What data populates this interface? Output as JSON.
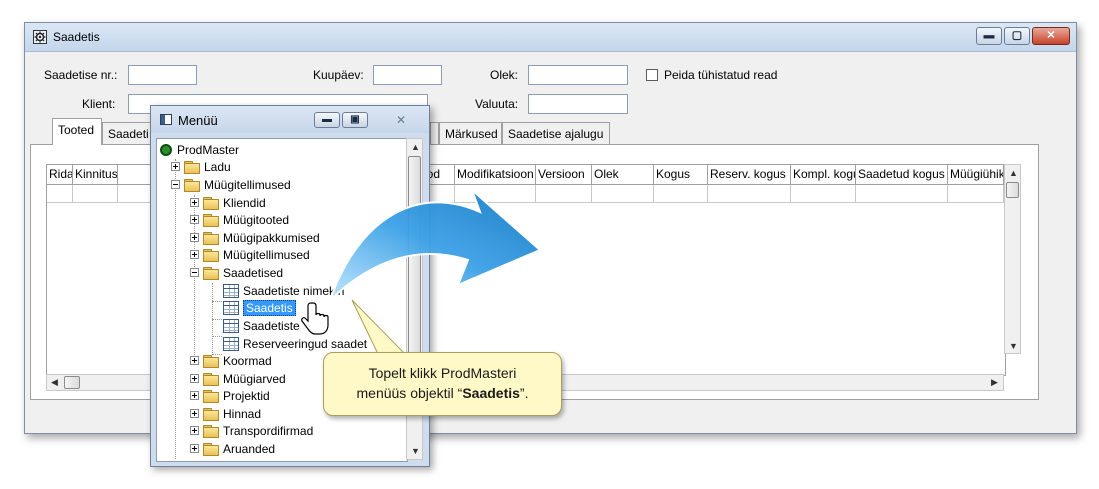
{
  "window": {
    "title": "Saadetis",
    "buttons": {
      "minimize": "▬",
      "maximize": "▢",
      "close": "✕"
    }
  },
  "form": {
    "shipment_no_label": "Saadetise nr.:",
    "shipment_no_value": "",
    "date_label": "Kuupäev:",
    "date_value": "",
    "status_label": "Olek:",
    "status_value": "",
    "hide_cancelled_label": "Peida tühistatud read",
    "client_label": "Klient:",
    "client_value": "",
    "currency_label": "Valuuta:",
    "currency_value": ""
  },
  "tabs": [
    {
      "label": "Tooted"
    },
    {
      "label": "Saadeti"
    },
    {
      "label": ""
    },
    {
      "label": "Märkused"
    },
    {
      "label": "Saadetise ajalugu"
    }
  ],
  "grid": {
    "columns": [
      "Rida",
      "Kinnitus",
      "",
      "ood",
      "Modifikatsioon",
      "Versioon",
      "Olek",
      "Kogus",
      "Reserv. kogus",
      "Kompl. kogus",
      "Saadetud kogus",
      "Müügiühik"
    ]
  },
  "menu": {
    "title": "Menüü",
    "tree": [
      {
        "label": "ProdMaster"
      },
      {
        "label": "Ladu"
      },
      {
        "label": "Müügitellimused"
      },
      {
        "label": "Kliendid"
      },
      {
        "label": "Müügitooted"
      },
      {
        "label": "Müügipakkumised"
      },
      {
        "label": "Müügitellimused"
      },
      {
        "label": "Saadetised"
      },
      {
        "label": "Saadetiste nimekiri"
      },
      {
        "label": "Saadetis"
      },
      {
        "label": "Saadetiste"
      },
      {
        "label": "Reserveeringud saadet"
      },
      {
        "label": "Koormad"
      },
      {
        "label": "Müügiarved"
      },
      {
        "label": "Projektid"
      },
      {
        "label": "Hinnad"
      },
      {
        "label": "Transpordifirmad"
      },
      {
        "label": "Aruanded"
      }
    ]
  },
  "callout": {
    "line1": "Topelt klikk ProdMasteri",
    "line2_prefix": "menüüs objektil “",
    "line2_bold": "Saadetis",
    "line2_suffix": "”."
  },
  "colors": {
    "accent_arrow": "#3aa0e6",
    "selection": "#3399ff",
    "callout_bg": "#fff9c7"
  }
}
